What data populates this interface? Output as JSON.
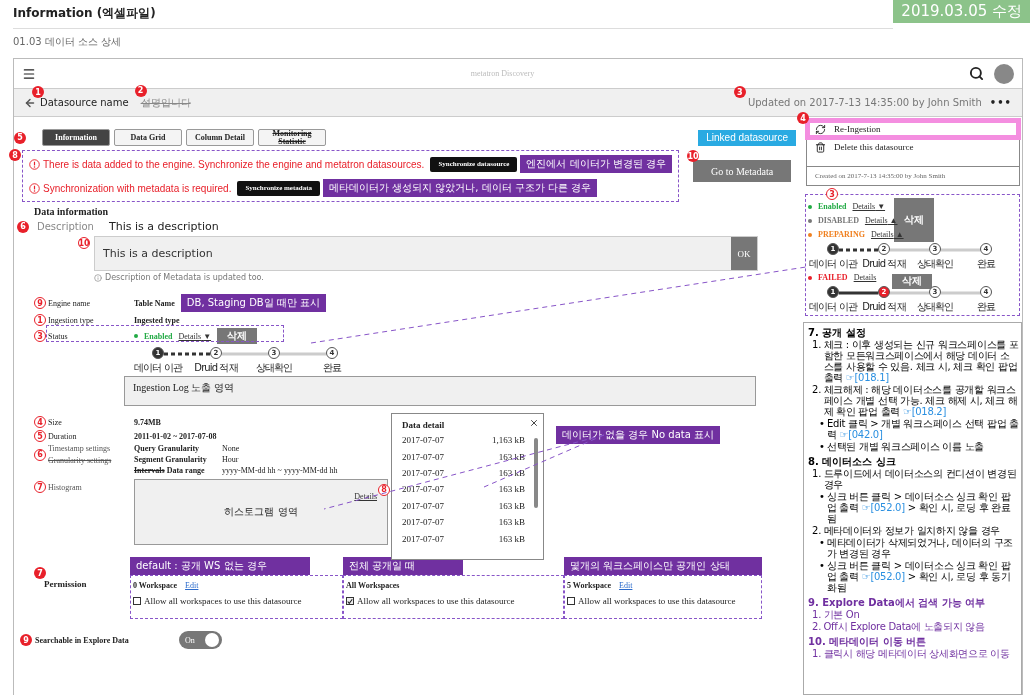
{
  "header": {
    "title": "Information (엑셀파일)",
    "subtitle": "01.03 데이터 소스 상세",
    "version": "2019.03.05 수정"
  },
  "topbar": {
    "brand": "metatron Discovery"
  },
  "subheader": {
    "name_marker": {
      "text": "1",
      "outlined": false
    },
    "name": "Datasource name",
    "description_marker": {
      "text": "2",
      "outlined": false
    },
    "description": "설명입니다",
    "description_struck": true,
    "updated_marker": {
      "text": "3",
      "outlined": false
    },
    "updated": "Updated on 2017-7-13 14:35:00 by John Smith",
    "more": "•••"
  },
  "tabs_marker": {
    "text": "5",
    "outlined": false
  },
  "tabs": [
    {
      "label": "Information",
      "selected": true,
      "struck": false
    },
    {
      "label": "Data Grid",
      "selected": false,
      "struck": false
    },
    {
      "label": "Column Detail",
      "selected": false,
      "struck": false
    },
    {
      "label": "Monitoring Statistic",
      "selected": false,
      "struck": true
    }
  ],
  "linked_button": "Linked datasource",
  "metadata_button": {
    "marker": {
      "text": "10",
      "outlined": false
    },
    "label": "Go to Metadata"
  },
  "alerts": {
    "marker": {
      "text": "8",
      "outlined": false
    },
    "items": [
      {
        "message": "There is data added to the engine. Synchronize the engine and metatron datasources.",
        "button": "Synchronize datasource",
        "note": "엔진에서 데이터가 변경된 경우"
      },
      {
        "message": "Synchronization with metadata is required.",
        "button": "Synchronize metadata",
        "note": "메타데이터가 생성되지 않았거나, 데이터 구조가 다른 경우"
      }
    ]
  },
  "data_info": {
    "heading": "Data information",
    "description_marker": {
      "text": "6",
      "outlined": false
    },
    "description_label": "Description",
    "description": "This is a description",
    "editor_marker": {
      "text": "10",
      "outlined": true
    },
    "editor_value": "This is a description",
    "ok": "OK",
    "hint": "Description of Metadata is updated too."
  },
  "rows": [
    {
      "marker": {
        "text": "9",
        "outlined": true
      },
      "label": "Engine name",
      "value": "Table Name",
      "note": "DB, Staging DB일 때만 표시"
    },
    {
      "marker": {
        "text": "1",
        "outlined": true
      },
      "label": "Ingestion type",
      "value": "Ingested type"
    }
  ],
  "status": {
    "marker": {
      "text": "3",
      "outlined": true
    },
    "label": "Status",
    "value": "Enabled",
    "color": "#22aa44",
    "details": "Details",
    "arrow": "▼",
    "delete_note": "삭제",
    "stepper": {
      "kind": "in-progress",
      "steps": [
        {
          "number": "1",
          "label": "데이터 이관",
          "done": true,
          "failed": false
        },
        {
          "number": "2",
          "label": "Druid 적재",
          "done": false,
          "failed": false
        },
        {
          "number": "3",
          "label": "상태확인",
          "done": false,
          "failed": false
        },
        {
          "number": "4",
          "label": "완료",
          "done": false,
          "failed": false
        }
      ]
    }
  },
  "log": "Ingestion Log 노출 영역",
  "size": {
    "marker": {
      "text": "4",
      "outlined": true
    },
    "label": "Size",
    "value": "9.74MB"
  },
  "duration": {
    "marker": {
      "text": "5",
      "outlined": true
    },
    "label": "Duration",
    "value": "2011-01-02 ~ 2017-07-08"
  },
  "timestamp": {
    "marker": {
      "text": "6",
      "outlined": true
    },
    "labels": [
      {
        "text": "Timestamp settings",
        "struck": false
      },
      {
        "text": "Granularity settings",
        "struck": true
      }
    ],
    "settings": [
      {
        "key": "Query Granularity",
        "value": "None"
      },
      {
        "key": "Segment Granularity",
        "value": "Hour"
      },
      {
        "key_struck": "Intervals",
        "key": "Data range",
        "value": "yyyy-MM-dd hh ~ yyyy-MM-dd hh"
      }
    ]
  },
  "histogram": {
    "marker": {
      "text": "7",
      "outlined": true
    },
    "label": "Histogram",
    "area": "히스토그램 영역",
    "details": "Details"
  },
  "data_detail": {
    "marker": {
      "text": "8",
      "outlined": true
    },
    "title": "Data detail",
    "note": "데이터가 없을 경우 No data 표시",
    "rows": [
      {
        "date": "2017-07-07",
        "size": "1,163 kB"
      },
      {
        "date": "2017-07-07",
        "size": "163 kB"
      },
      {
        "date": "2017-07-07",
        "size": "163 kB"
      },
      {
        "date": "2017-07-07",
        "size": "163 kB"
      },
      {
        "date": "2017-07-07",
        "size": "163 kB"
      },
      {
        "date": "2017-07-07",
        "size": "163 kB"
      },
      {
        "date": "2017-07-07",
        "size": "163 kB"
      }
    ]
  },
  "permission": {
    "marker": {
      "text": "7",
      "outlined": false
    },
    "label": "Permission",
    "cards": [
      {
        "note": "default : 공개 WS 없는 경우",
        "title": "0 Workspace",
        "edit": "Edit",
        "checked": false,
        "label": "Allow all workspaces to use this datasource"
      },
      {
        "note": "전체 공개일 때",
        "title": "All Workspaces",
        "checked": true,
        "label": "Allow all workspaces to use this datasource"
      },
      {
        "note": "몇개의 워크스페이스만 공개인 상태",
        "title": "5 Workspace",
        "edit": "Edit",
        "checked": false,
        "label": "Allow all workspaces to use this datasource"
      }
    ]
  },
  "searchable": {
    "marker": {
      "text": "9",
      "outlined": false
    },
    "label": "Searchable in Explore Data",
    "toggle": {
      "on": true,
      "label": "On"
    }
  },
  "menu": {
    "marker": {
      "text": "4",
      "outlined": false
    },
    "items": [
      {
        "kind": "refresh",
        "label": "Re-Ingestion",
        "highlighted": true
      },
      {
        "kind": "trash",
        "label": "Delete this datasource",
        "highlighted": false
      }
    ],
    "created": "Created on 2017-7-13 14:35:00 by John Smith"
  },
  "status_variants": {
    "marker": {
      "text": "3",
      "outlined": true
    },
    "items": [
      {
        "label": "Enabled",
        "color": "#22aa44",
        "details": "Details",
        "arrow": "▼",
        "delete_note": {
          "text": "삭제",
          "kind": "tall"
        }
      },
      {
        "label": "DISABLED",
        "color": "#777777",
        "details": "Details",
        "arrow": "▲"
      },
      {
        "label": "PREPARING",
        "color": "#f08020",
        "details": "Details",
        "arrow": "▲",
        "stepper": {
          "kind": "in-progress",
          "steps": [
            {
              "number": "1",
              "label": "데이터 이관",
              "done": true,
              "failed": false
            },
            {
              "number": "2",
              "label": "Druid 적재",
              "done": false,
              "failed": false
            },
            {
              "number": "3",
              "label": "상태확인",
              "done": false,
              "failed": false
            },
            {
              "number": "4",
              "label": "완료",
              "done": false,
              "failed": false
            }
          ]
        }
      },
      {
        "label": "FAILED",
        "color": "#e8202a",
        "details": "Details",
        "delete_note": {
          "text": "삭제",
          "kind": "short"
        },
        "stepper": {
          "kind": "failed",
          "steps": [
            {
              "number": "1",
              "label": "데이터 이관",
              "done": true,
              "failed": false
            },
            {
              "number": "2",
              "label": "Druid 적재",
              "done": false,
              "failed": true
            },
            {
              "number": "3",
              "label": "상태확인",
              "done": false,
              "failed": false
            },
            {
              "number": "4",
              "label": "완료",
              "done": false,
              "failed": false
            }
          ]
        }
      }
    ]
  },
  "notes": [
    {
      "heading": "7. 공개 설정",
      "color": "#000000",
      "items": [
        {
          "number": "1.",
          "text": "체크 : 이후 생성되는 신규 워크스페이스를 포함한 모든워크스페이스에서 해당 데이터 소스를 사용할 수 있음. 체크 시, 체크 확인 팝업 출력",
          "ref": "☞[018.1]"
        },
        {
          "number": "2.",
          "text": "체크해제 : 해당 데이터소스를 공개할 워크스페이스 개별 선택 가능. 체크 해제 시, 체크 해제 확인 팝업 출력",
          "ref": "☞[018.2]",
          "children": [
            {
              "number": "•",
              "text": "Edit 클릭 > 개별 워크스페이스 선택 팝업 출력",
              "ref": "☞[042.0]"
            },
            {
              "number": "•",
              "text": "선택된 개별 워크스페이스 이름 노출"
            }
          ]
        }
      ]
    },
    {
      "heading": "8. 데이터소스 싱크",
      "color": "#000000",
      "items": [
        {
          "number": "1.",
          "text": "드루이드에서 데이터소스의 컨디션이 변경된 경우",
          "children": [
            {
              "number": "•",
              "text": "싱크 버튼 클릭 > 데이터소스 싱크 확인 팝업 출력",
              "ref": "☞[052.0]",
              "after": "> 확인 시, 로딩 후 완료됨"
            }
          ]
        },
        {
          "number": "2.",
          "text": "메타데이터와 정보가 일치하지 않을 경우",
          "children": [
            {
              "number": "•",
              "text": "메타데이터가 삭제되었거나, 데이터의 구조가 변경된 경우"
            },
            {
              "number": "•",
              "text": "싱크 버튼 클릭 > 데이터소스 싱크 확인 팝업 출력",
              "ref": "☞[052.0]",
              "after": "> 확인 시, 로딩 후 동기화됨"
            }
          ]
        }
      ]
    },
    {
      "heading": "9. Explore Data에서 검색 가능 여부",
      "color": "#7030a0",
      "items": [
        {
          "number": "1.",
          "text": "기본 On"
        },
        {
          "number": "2.",
          "text": "Off시 Explore Data에 노출되지 않음"
        }
      ]
    },
    {
      "heading": "10. 메타데이터 이동 버튼",
      "color": "#7030a0",
      "items": [
        {
          "number": "1.",
          "text": "클릭시 해당 메타데이터 상세화면으로 이동"
        }
      ]
    }
  ]
}
